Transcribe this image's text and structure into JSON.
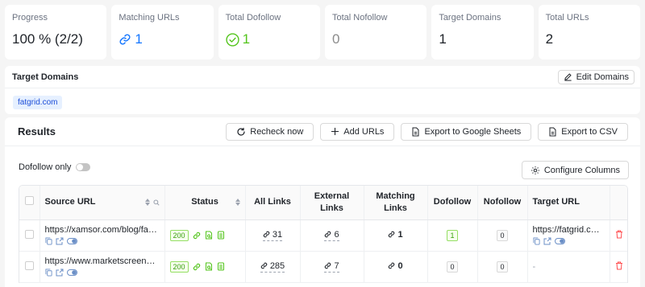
{
  "stats": [
    {
      "label": "Progress",
      "value": "100 % (2/2)",
      "tone": "plain",
      "icon": ""
    },
    {
      "label": "Matching URLs",
      "value": "1",
      "tone": "blue",
      "icon": "link-icon"
    },
    {
      "label": "Total Dofollow",
      "value": "1",
      "tone": "green",
      "icon": "check-circle-icon"
    },
    {
      "label": "Total Nofollow",
      "value": "0",
      "tone": "gray",
      "icon": ""
    },
    {
      "label": "Target Domains",
      "value": "1",
      "tone": "plain",
      "icon": ""
    },
    {
      "label": "Total URLs",
      "value": "2",
      "tone": "plain",
      "icon": ""
    }
  ],
  "target_domains": {
    "title": "Target Domains",
    "edit_label": "Edit Domains",
    "domains": [
      "fatgrid.com"
    ]
  },
  "results": {
    "title": "Results",
    "buttons": {
      "recheck": "Recheck now",
      "add_urls": "Add URLs",
      "export_sheets": "Export to Google Sheets",
      "export_csv": "Export to CSV",
      "configure": "Configure Columns"
    },
    "dofollow_only_label": "Dofollow only",
    "dofollow_only_on": false,
    "columns": {
      "source_url": "Source URL",
      "status": "Status",
      "all_links": "All Links",
      "external_links": "External Links",
      "matching_links": "Matching Links",
      "dofollow": "Dofollow",
      "nofollow": "Nofollow",
      "target_url": "Target URL"
    },
    "rows": [
      {
        "source_url": "https://xamsor.com/blog/fatgrid-review/",
        "status": "200",
        "all_links": "31",
        "external_links": "6",
        "matching_links": "1",
        "dofollow": "1",
        "nofollow": "0",
        "target_url": "https://fatgrid.com/"
      },
      {
        "source_url": "https://www.marketscreener.com/",
        "status": "200",
        "all_links": "285",
        "external_links": "7",
        "matching_links": "0",
        "dofollow": "0",
        "nofollow": "0",
        "target_url": "-"
      }
    ]
  },
  "colors": {
    "accent": "#1677ff",
    "success": "#52c41a",
    "danger": "#ff4d4f"
  }
}
